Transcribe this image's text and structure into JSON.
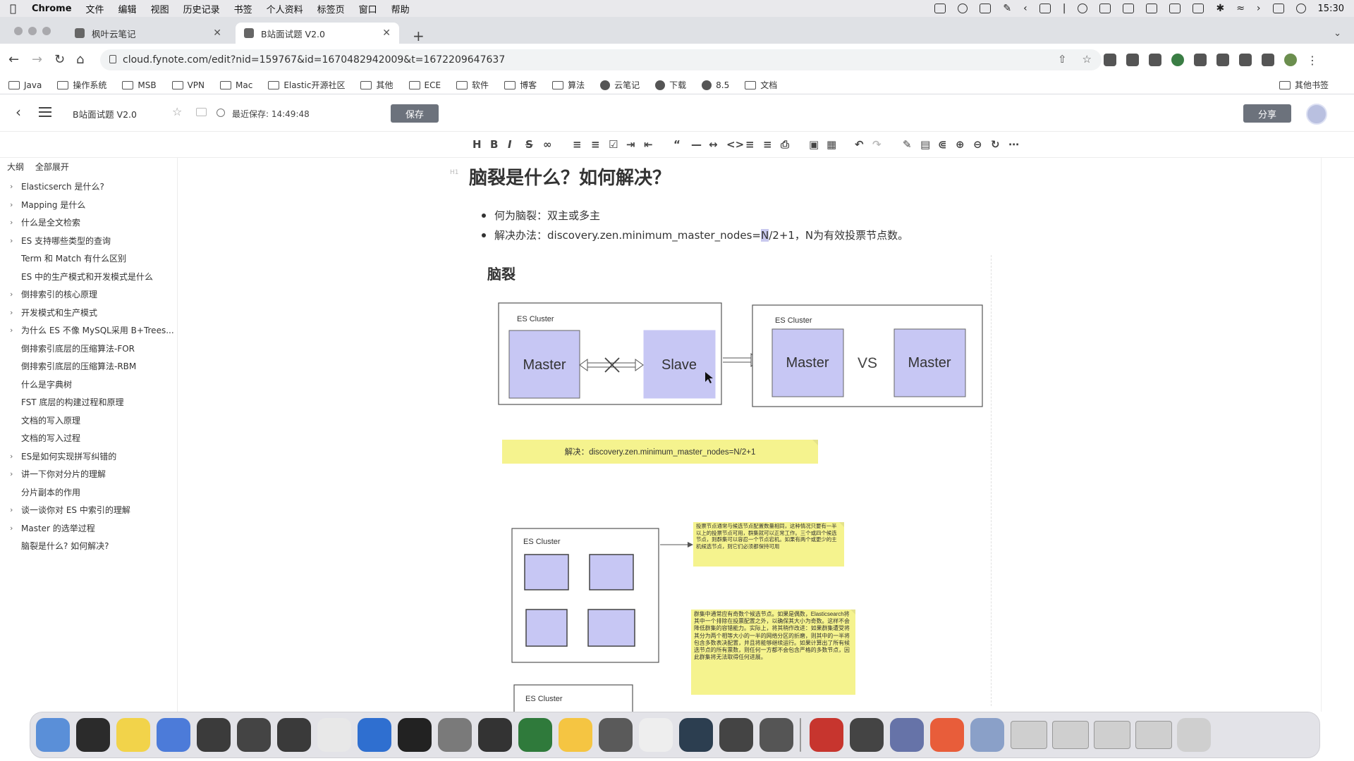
{
  "menubar": {
    "items": [
      "Chrome",
      "文件",
      "编辑",
      "视图",
      "历史记录",
      "书签",
      "个人资料",
      "标签页",
      "窗口",
      "帮助"
    ],
    "clock": "15:30"
  },
  "browser": {
    "tabs": [
      {
        "title": "枫叶云笔记",
        "active": false
      },
      {
        "title": "B站面试题 V2.0",
        "active": true
      }
    ],
    "url": "cloud.fynote.com/edit?nid=159767&id=1670482942009&t=1672209647637",
    "bookmarks": [
      "Java",
      "操作系统",
      "MSB",
      "VPN",
      "Mac",
      "Elastic开源社区",
      "其他",
      "ECE",
      "软件",
      "博客",
      "算法",
      "云笔记",
      "下载",
      "8.5",
      "文档"
    ],
    "bookmarks_other": "其他书签"
  },
  "app": {
    "doc_title": "B站面试题 V2.0",
    "last_saved": "最近保存: 14:49:48",
    "save_label": "保存",
    "share_label": "分享"
  },
  "sidebar": {
    "outline_label": "大纲",
    "expand_all_label": "全部展开",
    "items": [
      {
        "label": "Elasticserch 是什么?",
        "expandable": true
      },
      {
        "label": "Mapping 是什么",
        "expandable": true
      },
      {
        "label": "什么是全文检索",
        "expandable": true
      },
      {
        "label": "ES 支持哪些类型的查询",
        "expandable": true
      },
      {
        "label": "Term 和 Match 有什么区别",
        "expandable": false
      },
      {
        "label": "ES 中的生产模式和开发模式是什么",
        "expandable": false
      },
      {
        "label": "倒排索引的核心原理",
        "expandable": true
      },
      {
        "label": "开发模式和生产模式",
        "expandable": true
      },
      {
        "label": "为什么 ES 不像 MySQL采用 B+Trees...",
        "expandable": true
      },
      {
        "label": "倒排索引底层的压缩算法-FOR",
        "expandable": false
      },
      {
        "label": "倒排索引底层的压缩算法-RBM",
        "expandable": false
      },
      {
        "label": "什么是字典树",
        "expandable": false
      },
      {
        "label": "FST 底层的构建过程和原理",
        "expandable": false
      },
      {
        "label": "文档的写入原理",
        "expandable": false
      },
      {
        "label": "文档的写入过程",
        "expandable": false
      },
      {
        "label": "ES是如何实现拼写纠错的",
        "expandable": true
      },
      {
        "label": "讲一下你对分片的理解",
        "expandable": true
      },
      {
        "label": "分片副本的作用",
        "expandable": false
      },
      {
        "label": "谈一谈你对 ES 中索引的理解",
        "expandable": true
      },
      {
        "label": "Master 的选举过程",
        "expandable": true
      },
      {
        "label": "脑裂是什么? 如何解决?",
        "expandable": false
      }
    ]
  },
  "editor": {
    "h1_marker": "H1",
    "heading": "脑裂是什么？如何解决？",
    "bullet1": "何为脑裂：双主或多主",
    "bullet2_pre": "解决办法：discovery.zen.minimum_master_nodes=",
    "bullet2_sel": "N",
    "bullet2_post": "/2+1，N为有效投票节点数。"
  },
  "diagram": {
    "title": "脑裂",
    "cluster_label": "ES Cluster",
    "master": "Master",
    "slave": "Slave",
    "vs": "VS",
    "solution": "解决：discovery.zen.minimum_master_nodes=N/2+1",
    "note1": "投票节点通常与候选节点配置数量相同，这种情况只要有一半以上的投票节点可用，群集就可以正常工作。三个或四个候选节点，则群集可以容忍一个节点宕机。如果有两个或更少的主机候选节点，则它们必须都保持可用",
    "note2": "群集中通常应有奇数个候选节点。如果是偶数，Elasticsearch将其中一个排除在投票配置之外，以确保其大小为奇数。这样不会降低群集的容错能力。实际上，将其稍作改进：如果群集遭受将其分为两个相等大小的一半的网络分区的折磨，则其中的一半将包含多数表决配置，并且将能够继续运行。如果计算出了所有候选节点的所有票数，则任何一方都不会包含严格的多数节点，因此群集将无法取得任何进展。"
  }
}
